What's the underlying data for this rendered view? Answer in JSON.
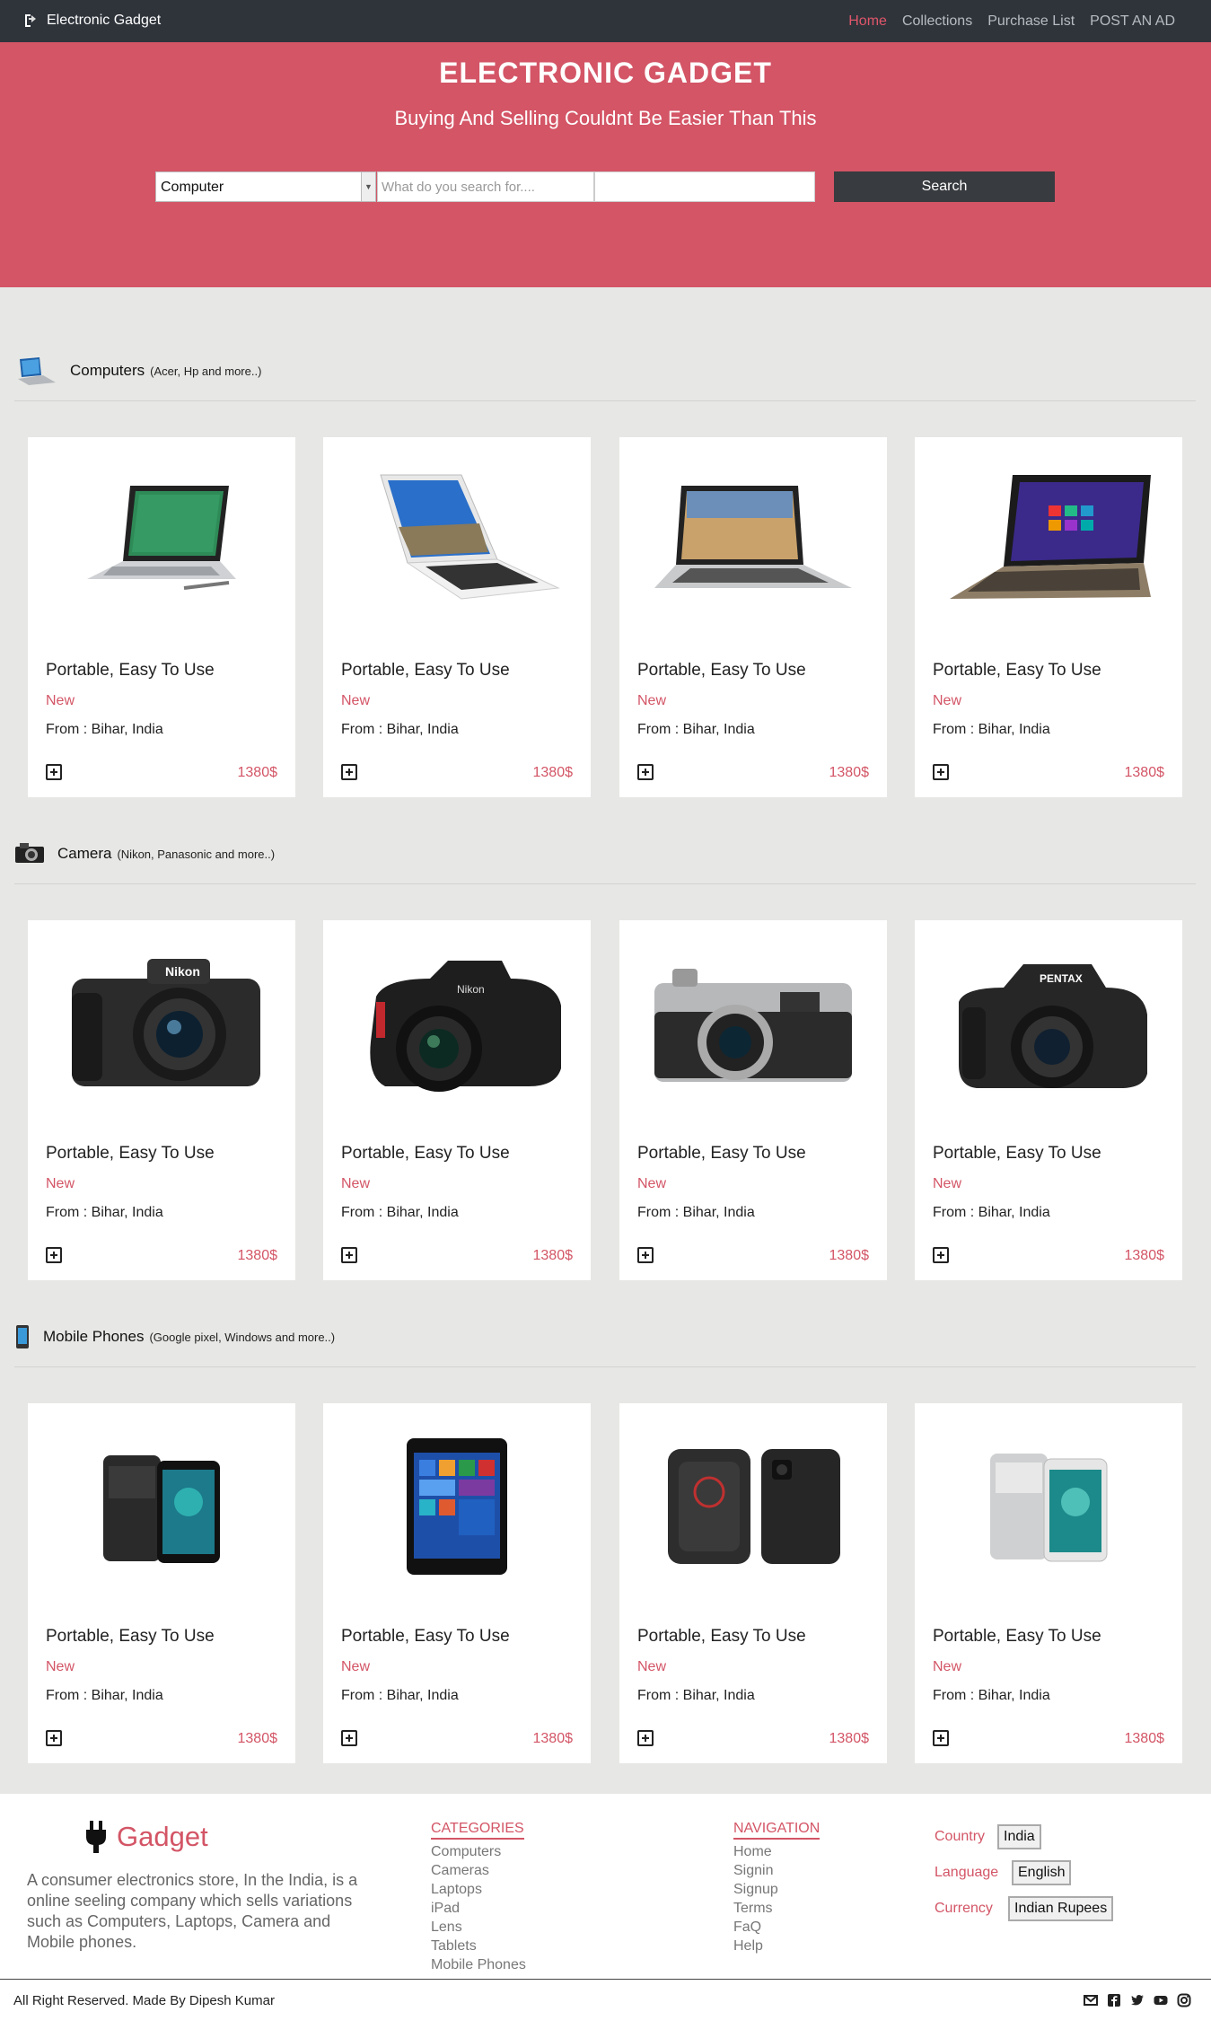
{
  "nav": {
    "brand": "Electronic Gadget",
    "links": [
      "Home",
      "Collections",
      "Purchase List",
      "POST AN AD"
    ]
  },
  "hero": {
    "title": "ELECTRONIC GADGET",
    "subtitle": "Buying And Selling Couldnt Be Easier Than This",
    "category_selected": "Computer",
    "search_placeholder": "What do you search for....",
    "search_button": "Search"
  },
  "sections": [
    {
      "title": "Computers",
      "subtitle": "(Acer, Hp and more..)",
      "icon": "laptop-icon",
      "items": [
        {
          "title": "Portable, Easy To Use",
          "condition": "New",
          "from": "From : Bihar, India",
          "price": "1380$",
          "image": "surface-laptop"
        },
        {
          "title": "Portable, Easy To Use",
          "condition": "New",
          "from": "From : Bihar, India",
          "price": "1380$",
          "image": "white-laptop"
        },
        {
          "title": "Portable, Easy To Use",
          "condition": "New",
          "from": "From : Bihar, India",
          "price": "1380$",
          "image": "chromebook"
        },
        {
          "title": "Portable, Easy To Use",
          "condition": "New",
          "from": "From : Bihar, India",
          "price": "1380$",
          "image": "windows8-laptop"
        }
      ]
    },
    {
      "title": "Camera",
      "subtitle": "(Nikon, Panasonic and more..)",
      "icon": "camera-icon",
      "items": [
        {
          "title": "Portable, Easy To Use",
          "condition": "New",
          "from": "From : Bihar, India",
          "price": "1380$",
          "image": "nikon-coolpix"
        },
        {
          "title": "Portable, Easy To Use",
          "condition": "New",
          "from": "From : Bihar, India",
          "price": "1380$",
          "image": "nikon-dslr"
        },
        {
          "title": "Portable, Easy To Use",
          "condition": "New",
          "from": "From : Bihar, India",
          "price": "1380$",
          "image": "fujifilm-x100"
        },
        {
          "title": "Portable, Easy To Use",
          "condition": "New",
          "from": "From : Bihar, India",
          "price": "1380$",
          "image": "pentax-dslr"
        }
      ]
    },
    {
      "title": "Mobile Phones",
      "subtitle": "(Google pixel, Windows and more..)",
      "icon": "phone-icon",
      "items": [
        {
          "title": "Portable, Easy To Use",
          "condition": "New",
          "from": "From : Bihar, India",
          "price": "1380$",
          "image": "pixel-black"
        },
        {
          "title": "Portable, Easy To Use",
          "condition": "New",
          "from": "From : Bihar, India",
          "price": "1380$",
          "image": "lumia"
        },
        {
          "title": "Portable, Easy To Use",
          "condition": "New",
          "from": "From : Bihar, India",
          "price": "1380$",
          "image": "htc-case"
        },
        {
          "title": "Portable, Easy To Use",
          "condition": "New",
          "from": "From : Bihar, India",
          "price": "1380$",
          "image": "pixel-silver"
        }
      ]
    }
  ],
  "footer": {
    "logo_text": "Gadget",
    "description": "A consumer electronics store, In the India, is a online seeling company which sells variations such as Computers, Laptops, Camera and Mobile phones.",
    "categories_title": "CATEGORIES",
    "categories": [
      "Computers",
      "Cameras",
      "Laptops",
      "iPad",
      "Lens",
      "Tablets",
      "Mobile Phones"
    ],
    "navigation_title": "NAVIGATION",
    "navigation": [
      "Home",
      "Signin",
      "Signup",
      "Terms",
      "FaQ",
      "Help"
    ],
    "country_label": "Country",
    "country_value": "India",
    "language_label": "Language",
    "language_value": "English",
    "currency_label": "Currency",
    "currency_value": "Indian Rupees",
    "copyright": "All Right Reserved. Made By Dipesh Kumar",
    "social": [
      "mail-icon",
      "facebook-icon",
      "twitter-icon",
      "youtube-icon",
      "instagram-icon"
    ]
  },
  "colors": {
    "accent": "#d35566",
    "navbar": "#2f343b",
    "page_bg": "#e7e8e5"
  }
}
